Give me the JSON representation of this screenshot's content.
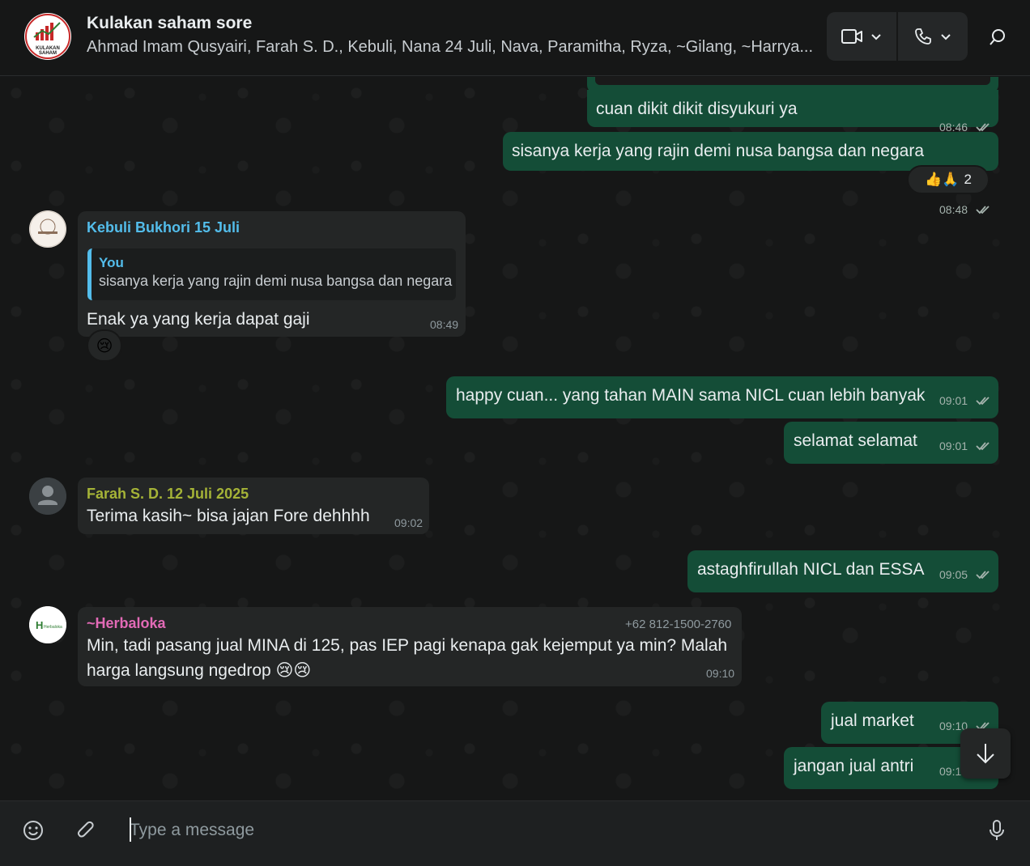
{
  "header": {
    "title": "Kulakan saham sore",
    "members": "Ahmad Imam Qusyairi, Farah S. D., Kebuli, Nana 24 Juli, Nava, Paramitha, Ryza, ~Gilang, ~Harrya...",
    "logo_text": "KULAKAN SAHAM"
  },
  "messages": [
    {
      "text": "cuan dikit dikit disyukuri ya",
      "time": "08:46"
    },
    {
      "text": "sisanya kerja yang rajin demi nusa bangsa dan negara",
      "time": "08:48",
      "reactions": "👍🙏",
      "reaction_count": "2"
    },
    {
      "sender": "Kebuli Bukhori 15 Juli",
      "quote_name": "You",
      "quote_text": "sisanya kerja yang rajin demi nusa bangsa dan negara",
      "text": "Enak ya yang kerja dapat gaji",
      "time": "08:49",
      "reaction": "😢"
    },
    {
      "text": "happy cuan... yang tahan MAIN sama NICL cuan lebih banyak",
      "time": "09:01"
    },
    {
      "text": "selamat selamat",
      "time": "09:01"
    },
    {
      "sender": "Farah S. D. 12 Juli 2025",
      "text": "Terima kasih~ bisa jajan Fore dehhhh",
      "time": "09:02"
    },
    {
      "text": "astaghfirullah NICL dan ESSA",
      "time": "09:05"
    },
    {
      "sender": "~Herbaloka",
      "phone": "+62 812-1500-2760",
      "line1": "Min, tadi pasang jual MINA di 125, pas IEP pagi kenapa gak kejemput ya min? Malah",
      "line2": "harga langsung ngedrop 😢😢",
      "time": "09:10",
      "avatar_text": "Herbaloka"
    },
    {
      "text": "jual market",
      "time": "09:10"
    },
    {
      "text": "jangan jual antri",
      "time": "09:1"
    }
  ],
  "composer": {
    "placeholder": "Type a message"
  },
  "colors": {
    "outgoing": "#144d37",
    "incoming": "#242626",
    "background": "#161717",
    "sender_kebuli": "#53bdeb",
    "sender_farah": "#a5b337",
    "sender_herbaloka": "#e26ab6"
  }
}
